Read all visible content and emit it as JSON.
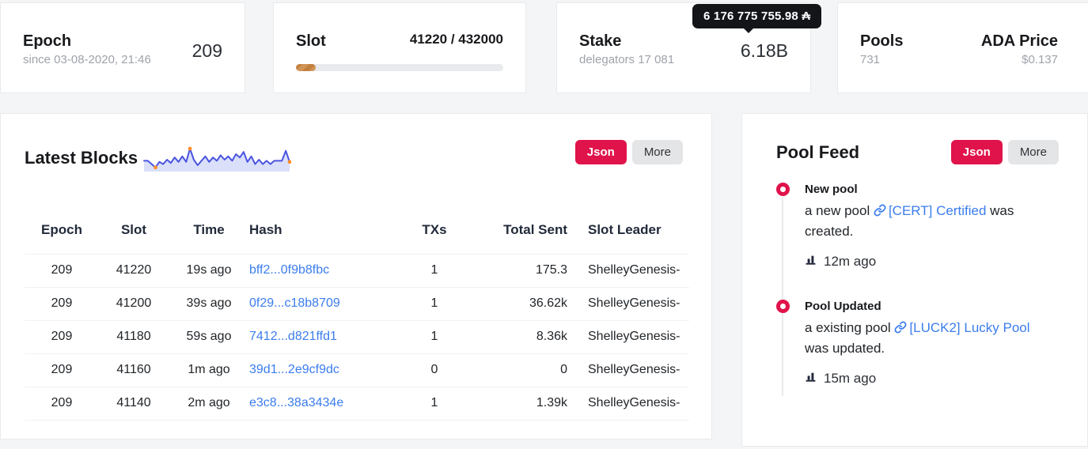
{
  "stats": {
    "epoch": {
      "title": "Epoch",
      "subtitle": "since 03-08-2020, 21:46",
      "value": "209"
    },
    "slot": {
      "title": "Slot",
      "value": "41220 / 432000",
      "progress_pct": 9.5
    },
    "stake": {
      "title": "Stake",
      "subtitle": "delegators 17 081",
      "value": "6.18B",
      "tooltip": "6 176 775 755.98 ₳"
    },
    "pools": {
      "title": "Pools",
      "value": "731"
    },
    "ada_price": {
      "title": "ADA Price",
      "value": "$0.137"
    }
  },
  "latest_blocks": {
    "title": "Latest Blocks",
    "json_button": "Json",
    "more_button": "More",
    "columns": [
      "Epoch",
      "Slot",
      "Time",
      "Hash",
      "TXs",
      "Total Sent",
      "Slot Leader"
    ],
    "rows": [
      {
        "epoch": "209",
        "slot": "41220",
        "time": "19s ago",
        "hash": "bff2...0f9b8fbc",
        "txs": "1",
        "total_sent": "175.3",
        "slot_leader": "ShelleyGenesis-"
      },
      {
        "epoch": "209",
        "slot": "41200",
        "time": "39s ago",
        "hash": "0f29...c18b8709",
        "txs": "1",
        "total_sent": "36.62k",
        "slot_leader": "ShelleyGenesis-"
      },
      {
        "epoch": "209",
        "slot": "41180",
        "time": "59s ago",
        "hash": "7412...d821ffd1",
        "txs": "1",
        "total_sent": "8.36k",
        "slot_leader": "ShelleyGenesis-"
      },
      {
        "epoch": "209",
        "slot": "41160",
        "time": "1m ago",
        "hash": "39d1...2e9cf9dc",
        "txs": "0",
        "total_sent": "0",
        "slot_leader": "ShelleyGenesis-"
      },
      {
        "epoch": "209",
        "slot": "41140",
        "time": "2m ago",
        "hash": "e3c8...38a3434e",
        "txs": "1",
        "total_sent": "1.39k",
        "slot_leader": "ShelleyGenesis-"
      }
    ]
  },
  "pool_feed": {
    "title": "Pool Feed",
    "json_button": "Json",
    "more_button": "More",
    "items": [
      {
        "title": "New pool",
        "text_before": "a new pool ",
        "link": "[CERT] Certified",
        "text_after": " was created.",
        "time": "12m ago"
      },
      {
        "title": "Pool Updated",
        "text_before": "a existing pool ",
        "link": "[LUCK2] Lucky Pool",
        "text_after": " was updated.",
        "time": "15m ago"
      }
    ]
  },
  "chart_data": {
    "type": "area",
    "title": "Latest Blocks sparkline",
    "xlabel": "",
    "ylabel": "",
    "values": [
      4.5,
      4.5,
      3,
      1.5,
      4,
      3,
      5,
      3.5,
      6,
      4,
      6.5,
      4,
      10,
      5,
      2.5,
      4.5,
      6.5,
      4,
      6,
      4.5,
      7,
      5,
      6.5,
      4.5,
      7.5,
      6,
      8.5,
      4,
      6.5,
      3,
      5,
      3,
      4.5,
      3,
      4.5,
      4.5,
      4.5,
      9,
      4
    ],
    "highlight_indices": [
      3,
      12,
      38
    ],
    "ylim": [
      0,
      11
    ],
    "line_color": "#4a54e0",
    "fill_color": "#cdd5f8",
    "dot_color": "#ff8e2b"
  },
  "colors": {
    "accent_red": "#e0134b",
    "link_blue": "#3b7ded",
    "progress_bronze": "#c2803e",
    "tooltip_bg": "#141519",
    "background": "#f4f5f7"
  }
}
